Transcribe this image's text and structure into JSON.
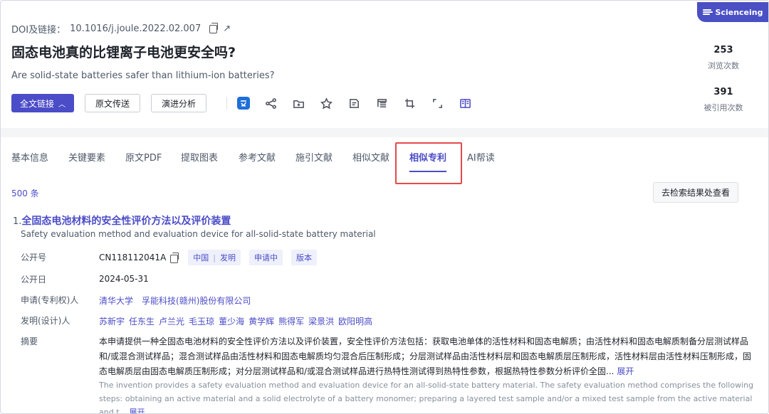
{
  "brand": {
    "label": "Scienceing"
  },
  "doi": {
    "label": "DOI及链接：",
    "value": "10.1016/j.joule.2022.02.007"
  },
  "paper": {
    "title": "固态电池真的比锂离子电池更安全吗?",
    "subtitle": "Are solid-state batteries safer than lithium-ion batteries?"
  },
  "stats": {
    "views_value": "253",
    "views_label": "浏览次数",
    "cites_value": "391",
    "cites_label": "被引用次数"
  },
  "actions": {
    "fulltext": "全文链接",
    "transfer": "原文传送",
    "evolution": "演进分析"
  },
  "tabs": [
    "基本信息",
    "关键要素",
    "原文PDF",
    "提取图表",
    "参考文献",
    "施引文献",
    "相似文献",
    "相似专利",
    "AI帮读"
  ],
  "active_tab": "相似专利",
  "results": {
    "count": "500 条",
    "goto_search": "去检索结果处查看"
  },
  "patent": {
    "index": "1.",
    "title": "全固态电池材料的安全性评价方法以及评价装置",
    "title_en": "Safety evaluation method and evaluation device for all-solid-state battery material",
    "pub_no_label": "公开号",
    "pub_no": "CN118112041A",
    "tag_country": "中国",
    "tag_type": "发明",
    "tag_status": "申请中",
    "tag_version": "版本",
    "pub_date_label": "公开日",
    "pub_date": "2024-05-31",
    "applicant_label": "申请(专利权)人",
    "applicants": [
      "清华大学",
      "孚能科技(赣州)股份有限公司"
    ],
    "inventor_label": "发明(设计)人",
    "inventors": [
      "苏新宇",
      "任东生",
      "卢兰光",
      "毛玉琼",
      "董少海",
      "黄学辉",
      "熊得军",
      "梁景洪",
      "欧阳明高"
    ],
    "abstract_label": "摘要",
    "abstract": "本申请提供一种全固态电池材料的安全性评价方法以及评价装置，安全性评价方法包括：获取电池单体的活性材料和固态电解质；由活性材料和固态电解质制备分层测试样品和/或混合测试样品；混合测试样品由活性材料和固态电解质均匀混合后压制形成；分层测试样品由活性材料层和固态电解质层压制形成，活性材料层由活性材料压制形成，固态电解质层由固态电解质压制形成；对分层测试样品和/或混合测试样品进行热特性测试得到热特性参数，根据热特性参数分析评价全固...",
    "abstract_en": "The invention provides a safety evaluation method and evaluation device for an all-solid-state battery material. The safety evaluation method comprises the following steps: obtaining an active material and a solid electrolyte of a battery monomer; preparing a layered test sample and/or a mixed test sample from the active material and t...",
    "expand": "展开"
  }
}
